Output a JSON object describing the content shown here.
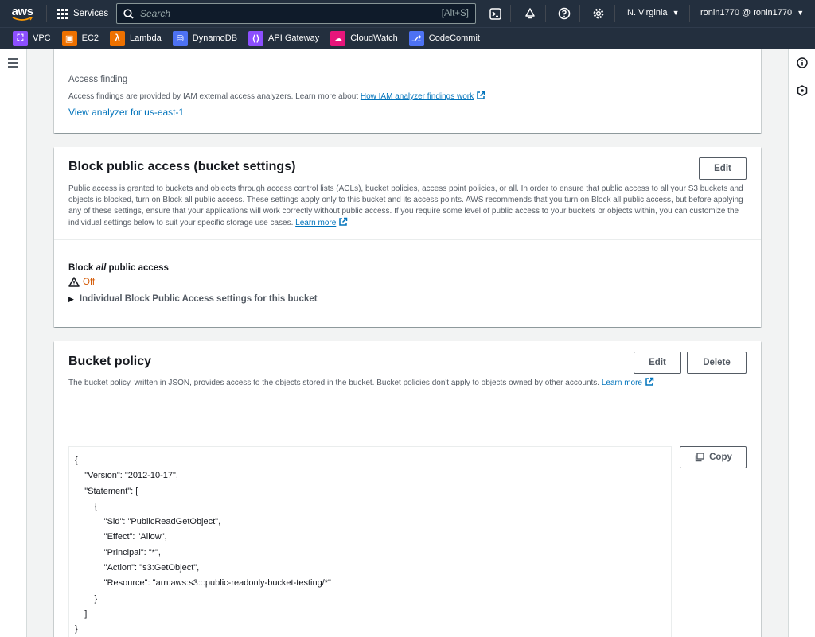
{
  "nav": {
    "logo": "aws",
    "services": "Services",
    "search_placeholder": "Search",
    "search_shortcut": "[Alt+S]",
    "region": "N. Virginia",
    "account": "ronin1770 @ ronin1770"
  },
  "favorites": [
    {
      "label": "VPC",
      "color": "#8c4fff",
      "icon": "vpc-icon"
    },
    {
      "label": "EC2",
      "color": "#ed7100",
      "icon": "ec2-icon"
    },
    {
      "label": "Lambda",
      "color": "#ed7100",
      "icon": "lambda-icon"
    },
    {
      "label": "DynamoDB",
      "color": "#4d72f3",
      "icon": "dynamodb-icon"
    },
    {
      "label": "API Gateway",
      "color": "#8c4fff",
      "icon": "api-gateway-icon"
    },
    {
      "label": "CloudWatch",
      "color": "#e7157b",
      "icon": "cloudwatch-icon"
    },
    {
      "label": "CodeCommit",
      "color": "#4d72f3",
      "icon": "codecommit-icon"
    }
  ],
  "access_finding": {
    "label": "Access finding",
    "desc": "Access findings are provided by IAM external access analyzers. Learn more about ",
    "desc_link": "How IAM analyzer findings work",
    "link": "View analyzer for us-east-1"
  },
  "bpa": {
    "title": "Block public access (bucket settings)",
    "edit": "Edit",
    "desc": "Public access is granted to buckets and objects through access control lists (ACLs), bucket policies, access point policies, or all. In order to ensure that public access to all your S3 buckets and objects is blocked, turn on Block all public access. These settings apply only to this bucket and its access points. AWS recommends that you turn on Block all public access, but before applying any of these settings, ensure that your applications will work correctly without public access. If you require some level of public access to your buckets or objects within, you can customize the individual settings below to suit your specific storage use cases. ",
    "learn_more": "Learn more",
    "label_pre": "Block ",
    "label_em": "all",
    "label_post": " public access",
    "status": "Off",
    "expander": "Individual Block Public Access settings for this bucket"
  },
  "policy": {
    "title": "Bucket policy",
    "edit": "Edit",
    "delete": "Delete",
    "copy": "Copy",
    "desc": "The bucket policy, written in JSON, provides access to the objects stored in the bucket. Bucket policies don't apply to objects owned by other accounts. ",
    "learn_more": "Learn more",
    "lines": [
      "{",
      "    \"Version\": \"2012-10-17\",",
      "    \"Statement\": [",
      "        {",
      "            \"Sid\": \"PublicReadGetObject\",",
      "            \"Effect\": \"Allow\",",
      "            \"Principal\": \"*\",",
      "            \"Action\": \"s3:GetObject\",",
      "            \"Resource\": \"arn:aws:s3:::public-readonly-bucket-testing/*\"",
      "        }",
      "    ]",
      "}"
    ]
  },
  "colors": {
    "nav_bg": "#232f3e",
    "link": "#0073bb",
    "warning": "#d45b07"
  }
}
